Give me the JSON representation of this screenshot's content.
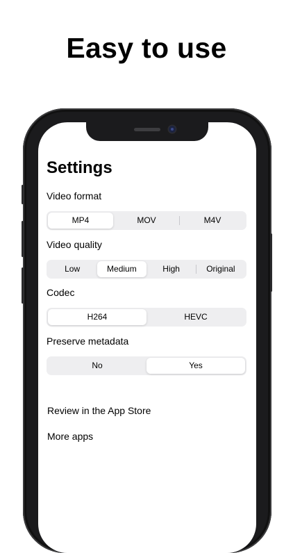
{
  "headline": "Easy to use",
  "settings": {
    "title": "Settings",
    "video_format": {
      "label": "Video format",
      "options": [
        "MP4",
        "MOV",
        "M4V"
      ],
      "selected": "MP4"
    },
    "video_quality": {
      "label": "Video quality",
      "options": [
        "Low",
        "Medium",
        "High",
        "Original"
      ],
      "selected": "Medium"
    },
    "codec": {
      "label": "Codec",
      "options": [
        "H264",
        "HEVC"
      ],
      "selected": "H264"
    },
    "preserve_metadata": {
      "label": "Preserve metadata",
      "options": [
        "No",
        "Yes"
      ],
      "selected": "Yes"
    },
    "links": {
      "review": "Review in the App Store",
      "more_apps": "More apps"
    }
  },
  "colors": {
    "segment_bg": "#eeeef0",
    "segment_selected": "#ffffff",
    "phone_frame": "#1b1b1d"
  }
}
